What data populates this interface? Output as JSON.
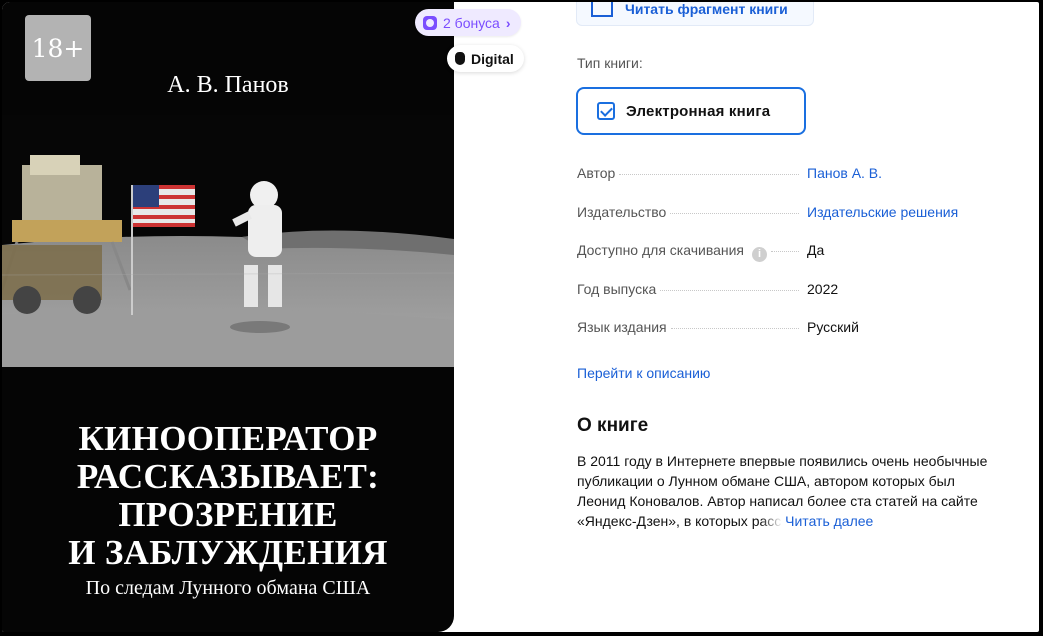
{
  "cover": {
    "age_rating": "18+",
    "author": "А. В. Панов",
    "title_lines": [
      "КИНООПЕРАТОР",
      "РАССКАЗЫВАЕТ:",
      "ПРОЗРЕНИЕ",
      "И ЗАБЛУЖДЕНИЯ"
    ],
    "subtitle": "По следам Лунного обмана США"
  },
  "badges": {
    "bonus": "2 бонуса",
    "digital": "Digital"
  },
  "actions": {
    "read_fragment": "Читать фрагмент книги"
  },
  "book_type": {
    "label": "Тип книги:",
    "selected": "Электронная книга"
  },
  "specs": [
    {
      "key": "Автор",
      "value": "Панов А. В.",
      "link": true
    },
    {
      "key": "Издательство",
      "value": "Издательские решения",
      "link": true
    },
    {
      "key": "Доступно для скачивания",
      "value": "Да",
      "link": false,
      "info": true
    },
    {
      "key": "Год выпуска",
      "value": "2022",
      "link": false
    },
    {
      "key": "Язык издания",
      "value": "Русский",
      "link": false
    }
  ],
  "goto_description": "Перейти к описанию",
  "about": {
    "title": "О книге",
    "lines": [
      "В 2011 году в Интернете впервые появились очень необычные",
      "публикации о Лунном обмане США, автором которых был",
      "Леонид Коновалов. Автор написал более ста статей на сайте"
    ],
    "last_line_start": "«Яндекс-Дзен», в которых ",
    "last_line_faded": "расс",
    "read_more": "Читать далее"
  },
  "colors": {
    "accent": "#1a5fd6",
    "bonus": "#7b4dff",
    "cover_bg": "#050505"
  }
}
